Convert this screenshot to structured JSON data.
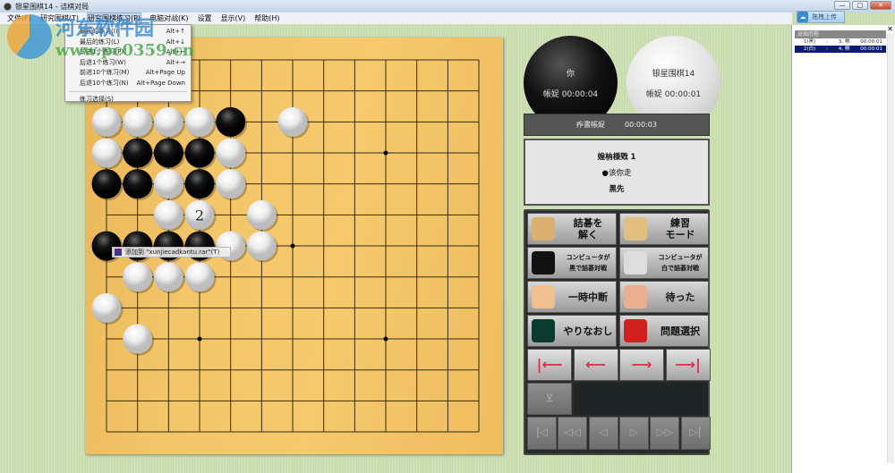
{
  "window": {
    "title": "银星围棋14 - 诘棋对局",
    "buttons": [
      "—",
      "□",
      "✕"
    ]
  },
  "menu": [
    "文件(F)",
    "研究围棋(T)",
    "研究围棋练习(P)",
    "电脑对战(K)",
    "设置",
    "显示(V)",
    "帮助(H)"
  ],
  "active_menu_index": 2,
  "dropdown": [
    {
      "label": "最初的练习(I)",
      "shortcut": "Alt+↑"
    },
    {
      "label": "最后的练习(L)",
      "shortcut": "Alt+↓"
    },
    {
      "label": "前进1个练习(P)",
      "shortcut": "Alt+←"
    },
    {
      "label": "后退1个练习(W)",
      "shortcut": "Alt+→"
    },
    {
      "label": "前进10个练习(M)",
      "shortcut": "Alt+Page Up"
    },
    {
      "label": "后退10个练习(N)",
      "shortcut": "Alt+Page Down"
    }
  ],
  "dropdown_last": {
    "label": "练习选择(S)",
    "shortcut": ""
  },
  "context_tip": "添加到 \"xunjiecadkantu.rar\"(T)",
  "watermark": {
    "name": "河东软件园",
    "url": "www.pc0359.cn"
  },
  "board": {
    "size": 13,
    "star_points": [
      [
        3,
        3
      ],
      [
        9,
        3
      ],
      [
        6,
        6
      ],
      [
        3,
        9
      ],
      [
        9,
        9
      ]
    ],
    "stones": [
      [
        0,
        2,
        "W"
      ],
      [
        1,
        2,
        "W"
      ],
      [
        2,
        2,
        "W"
      ],
      [
        3,
        2,
        "W"
      ],
      [
        4,
        2,
        "B"
      ],
      [
        6,
        2,
        "W"
      ],
      [
        0,
        3,
        "W"
      ],
      [
        1,
        3,
        "B"
      ],
      [
        2,
        3,
        "B"
      ],
      [
        3,
        3,
        "B"
      ],
      [
        4,
        3,
        "W"
      ],
      [
        0,
        4,
        "B"
      ],
      [
        1,
        4,
        "B"
      ],
      [
        2,
        4,
        "W"
      ],
      [
        3,
        4,
        "B"
      ],
      [
        4,
        4,
        "W"
      ],
      [
        2,
        5,
        "W"
      ],
      [
        3,
        5,
        "W",
        "2"
      ],
      [
        5,
        5,
        "W"
      ],
      [
        0,
        6,
        "B"
      ],
      [
        1,
        6,
        "B"
      ],
      [
        2,
        6,
        "B"
      ],
      [
        3,
        6,
        "B"
      ],
      [
        4,
        6,
        "W"
      ],
      [
        5,
        6,
        "W"
      ],
      [
        1,
        7,
        "W"
      ],
      [
        2,
        7,
        "W"
      ],
      [
        3,
        7,
        "W"
      ],
      [
        0,
        8,
        "W"
      ],
      [
        1,
        9,
        "W"
      ]
    ]
  },
  "players": {
    "black": {
      "name": "你",
      "time_label": "帳娖",
      "time": "00:00:04"
    },
    "white": {
      "name": "银星围棋14",
      "time_label": "帳娖",
      "time": "00:00:01"
    }
  },
  "timer": {
    "label": "痄書帳娖",
    "time": "00:00:03"
  },
  "status": {
    "title": "媓枘棅戣 1",
    "turn": "●该你走",
    "first": "黑先"
  },
  "buttons": {
    "solve": "詰碁を\n解く",
    "practice": "練習\nモード",
    "cpu_black": "コンピュータが\n黒で詰碁対戦",
    "cpu_white": "コンピュータが\n白で詰碁対戦",
    "pause": "一時中断",
    "undo": "待った",
    "redo": "やりなおし",
    "select": "問題選択"
  },
  "nav": {
    "first": "|⟵",
    "prev": "⟵",
    "next": "⟶",
    "last": "⟶|",
    "down": "⊻"
  },
  "disabled_nav": [
    "|◁",
    "◁◁",
    "◁",
    "▷",
    "▷▷",
    "▷|"
  ],
  "sidebar": {
    "header": "对局历程",
    "close": "✕",
    "rows": [
      {
        "move": "1(黑)",
        "sep": ":",
        "pos": "3, 棋",
        "time": "00:00:01",
        "selected": false
      },
      {
        "move": "2(白)",
        "sep": ":",
        "pos": "4, 棋",
        "time": "00:00:01",
        "selected": true
      }
    ]
  },
  "upload": {
    "label": "拖拽上传"
  }
}
